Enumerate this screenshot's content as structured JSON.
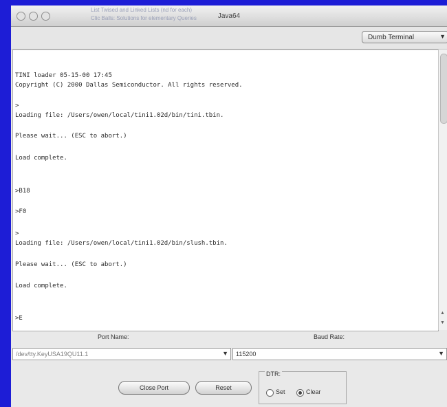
{
  "window": {
    "title": "Java64",
    "background_caption_1": "List Twised and Linked Lists (nd for each)",
    "background_caption_2": "Clic Balls: Solutions for elementary Queries"
  },
  "toolbar": {
    "mode_popup": "Dumb Terminal"
  },
  "console": {
    "lines": [
      "TINI loader 05-15-00 17:45",
      "Copyright (C) 2000 Dallas Semiconductor. All rights reserved.",
      ">",
      "Loading file: /Users/owen/local/tini1.02d/bin/tini.tbin.",
      "Please wait... (ESC to abort.)",
      "Load complete.",
      ">B18",
      ">F0",
      ">",
      "Loading file: /Users/owen/local/tini1.02d/bin/slush.tbin.",
      "Please wait... (ESC to abort.)",
      "Load complete.",
      ">E"
    ]
  },
  "settings": {
    "port_label": "Port Name:",
    "port_value": "/dev/tty.KeyUSA19QU11.1",
    "baud_label": "Baud Rate:",
    "baud_value": "115200"
  },
  "buttons": {
    "close_port": "Close Port",
    "reset": "Reset"
  },
  "dtr": {
    "label": "DTR:",
    "set": "Set",
    "clear": "Clear",
    "selected": "Clear"
  },
  "colors": {
    "desktop": "#1d1dd6",
    "window": "#e9e9e9"
  }
}
